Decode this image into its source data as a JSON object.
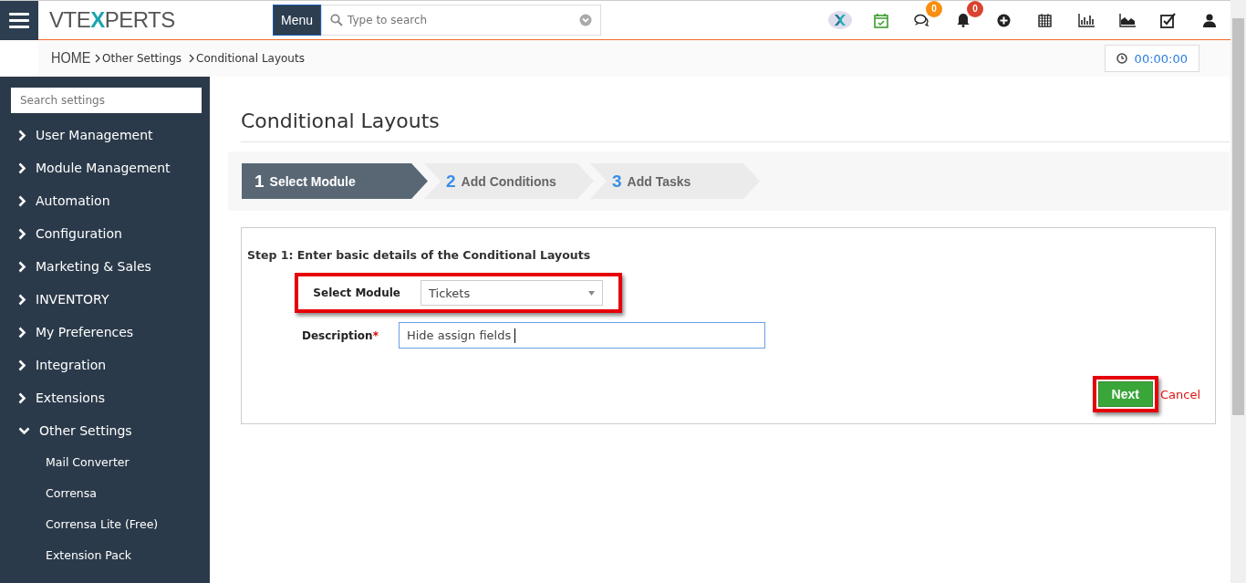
{
  "header": {
    "logo": [
      {
        "text": "VTE",
        "kind": "plain"
      },
      {
        "text": "X",
        "kind": "accent"
      },
      {
        "text": "PERTS",
        "kind": "plain"
      }
    ],
    "menu_button": "Menu",
    "search": {
      "placeholder": "Type to search"
    },
    "icons": [
      {
        "kind": "brand"
      },
      {
        "kind": "calendar-check"
      },
      {
        "kind": "chat",
        "badge": "0",
        "color": "#f98e10"
      },
      {
        "kind": "bell",
        "badge": "0",
        "color": "#d9432f"
      },
      {
        "kind": "plus"
      },
      {
        "kind": "calendar"
      },
      {
        "kind": "bar-chart"
      },
      {
        "kind": "area-chart"
      },
      {
        "kind": "task"
      },
      {
        "kind": "user"
      }
    ]
  },
  "breadcrumb": {
    "home": "HOME",
    "items": [
      "Other Settings",
      "Conditional Layouts"
    ],
    "timer": "00:00:00"
  },
  "sidebar": {
    "search": {
      "placeholder": "Search settings"
    },
    "items": [
      {
        "label": "User Management",
        "expanded": false
      },
      {
        "label": "Module Management",
        "expanded": false
      },
      {
        "label": "Automation",
        "expanded": false
      },
      {
        "label": "Configuration",
        "expanded": false
      },
      {
        "label": "Marketing & Sales",
        "expanded": false
      },
      {
        "label": "INVENTORY",
        "expanded": false
      },
      {
        "label": "My Preferences",
        "expanded": false
      },
      {
        "label": "Integration",
        "expanded": false
      },
      {
        "label": "Extensions",
        "expanded": false
      },
      {
        "label": "Other Settings",
        "expanded": true,
        "children": [
          {
            "label": "Mail Converter"
          },
          {
            "label": "Corrensa"
          },
          {
            "label": "Corrensa Lite (Free)"
          },
          {
            "label": "Extension Pack"
          }
        ]
      }
    ]
  },
  "page": {
    "title": "Conditional Layouts",
    "steps": [
      {
        "number": "1",
        "label": "Select Module",
        "selected": true
      },
      {
        "number": "2",
        "label": "Add Conditions",
        "selected": false
      },
      {
        "number": "3",
        "label": "Add Tasks",
        "selected": false
      }
    ],
    "form": {
      "heading": "Step 1: Enter basic details of the Conditional Layouts",
      "fields": [
        {
          "kind": "select",
          "label": "Select Module",
          "value": "Tickets",
          "highlighted": true
        },
        {
          "kind": "text",
          "label": "Description",
          "value": "Hide assign fields",
          "required_mark": "*",
          "highlighted": false
        }
      ],
      "next_button": {
        "label": "Next",
        "highlighted": true
      },
      "cancel": "Cancel"
    }
  }
}
